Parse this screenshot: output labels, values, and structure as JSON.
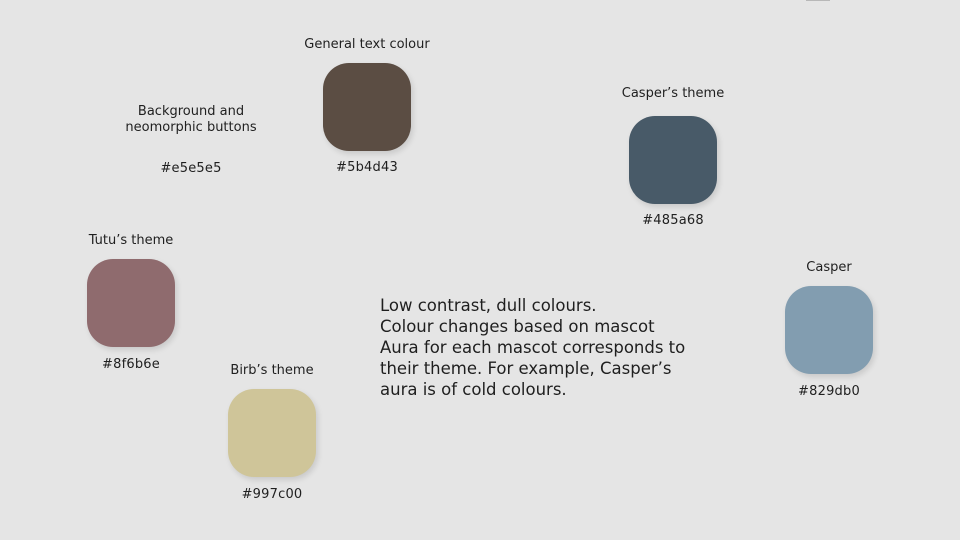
{
  "background": {
    "label_line1": "Background and",
    "label_line2": "neomorphic buttons",
    "hex": "#e5e5e5",
    "color": "#e5e5e5"
  },
  "general_text": {
    "label": "General text colour",
    "hex": "#5b4d43",
    "color": "#5b4d43"
  },
  "caspers_theme": {
    "label": "Casper’s theme",
    "hex": "#485a68",
    "color": "#485a68"
  },
  "tutus_theme": {
    "label": "Tutu’s theme",
    "hex": "#8f6b6e",
    "color": "#8f6b6e"
  },
  "birbs_theme": {
    "label": "Birb’s theme",
    "hex": "#997c00",
    "color": "#cfc599"
  },
  "casper": {
    "label": "Casper",
    "hex": "#829db0",
    "color": "#829db0"
  },
  "note": {
    "line1": "Low contrast, dull colours.",
    "line2": "Colour changes based on mascot",
    "line3": "Aura for each mascot corresponds to",
    "line4": "their theme. For example, Casper’s",
    "line5": "aura is of cold colours."
  }
}
